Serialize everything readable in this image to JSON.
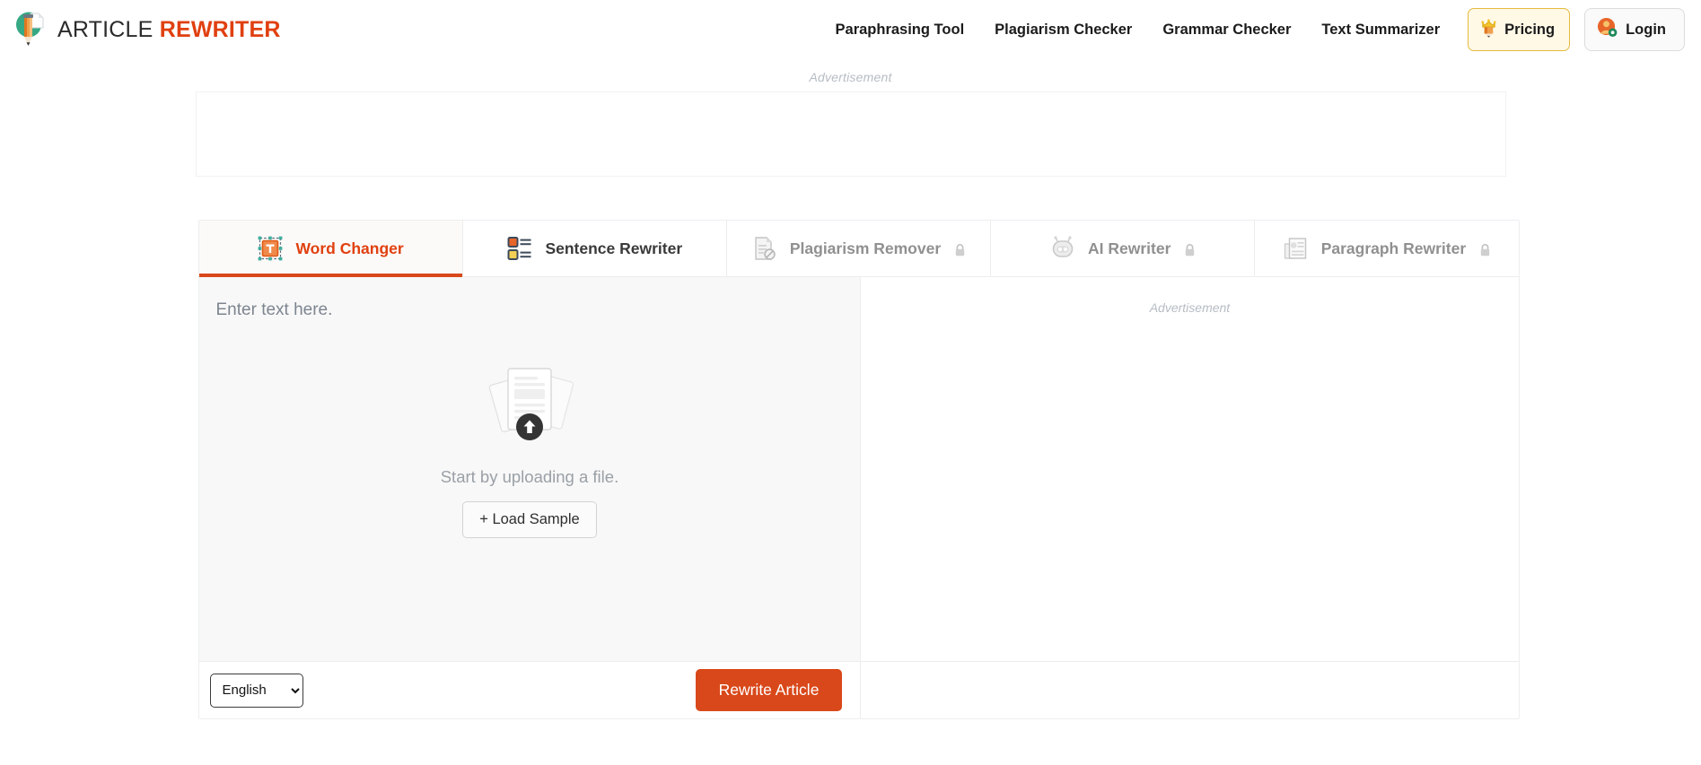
{
  "brand": {
    "word1": "ARTICLE",
    "word2": "REWRITER",
    "logo_icon": "pencil-document-logo-icon",
    "accent_color": "#e04010"
  },
  "header": {
    "nav_links": [
      {
        "label": "Paraphrasing Tool",
        "name": "nav-paraphrasing-tool"
      },
      {
        "label": "Plagiarism Checker",
        "name": "nav-plagiarism-checker"
      },
      {
        "label": "Grammar Checker",
        "name": "nav-grammar-checker"
      },
      {
        "label": "Text Summarizer",
        "name": "nav-text-summarizer"
      }
    ],
    "pricing": {
      "label": "Pricing",
      "icon": "crown-pencil-icon",
      "bg": "#fff9e6",
      "border": "#e6b93d"
    },
    "login": {
      "label": "Login",
      "icon": "user-avatar-icon",
      "bg": "#fafafa",
      "border": "#dcdcdc"
    }
  },
  "ads": {
    "top_label": "Advertisement",
    "right_label": "Advertisement"
  },
  "tabs": [
    {
      "label": "Word Changer",
      "icon": "text-selection-t-icon",
      "active": true,
      "locked": false
    },
    {
      "label": "Sentence Rewriter",
      "icon": "two-list-blocks-icon",
      "active": false,
      "locked": false
    },
    {
      "label": "Plagiarism Remover",
      "icon": "document-no-entry-icon",
      "active": false,
      "locked": true
    },
    {
      "label": "AI Rewriter",
      "icon": "robot-head-icon",
      "active": false,
      "locked": true
    },
    {
      "label": "Paragraph Rewriter",
      "icon": "paragraph-pages-icon",
      "active": false,
      "locked": true
    }
  ],
  "editor": {
    "placeholder": "Enter text here.",
    "upload_caption": "Start by uploading a file.",
    "upload_icon": "document-stack-upload-icon",
    "load_sample_label": "+ Load Sample"
  },
  "toolbar": {
    "language_value": "English",
    "language_options": [
      "English"
    ],
    "rewrite_label": "Rewrite Article",
    "rewrite_color": "#d9481a"
  }
}
